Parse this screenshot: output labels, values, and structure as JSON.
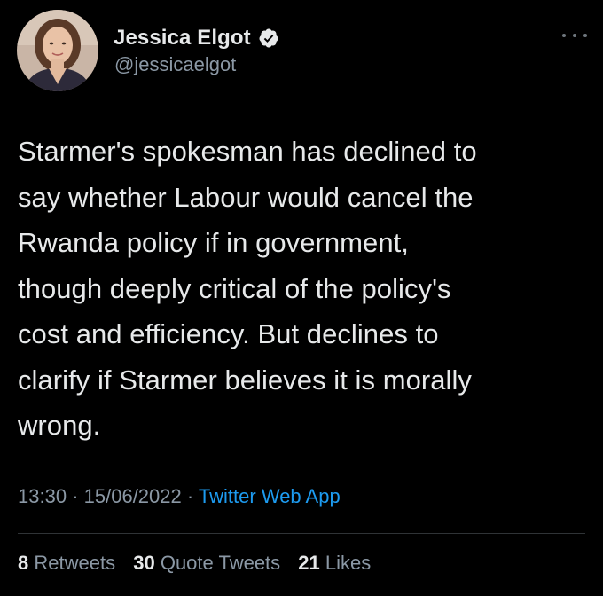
{
  "author": {
    "display_name": "Jessica Elgot",
    "handle": "@jessicaelgot",
    "verified": true,
    "avatar_icon": "profile-photo"
  },
  "tweet": {
    "text": "Starmer's spokesman has declined to\nsay whether Labour would cancel the\nRwanda policy if in government,\nthough deeply critical of the policy's\ncost and efficiency. But declines to\nclarify if Starmer believes it is morally\nwrong.",
    "time": "13:30",
    "separator": "·",
    "date": "15/06/2022",
    "source": "Twitter Web App"
  },
  "stats": {
    "retweets_count": "8",
    "retweets_label": "Retweets",
    "quotes_count": "30",
    "quotes_label": "Quote Tweets",
    "likes_count": "21",
    "likes_label": "Likes"
  },
  "colors": {
    "background": "#000000",
    "text_primary": "#e7e9ea",
    "text_secondary": "#8b98a5",
    "link": "#1d9bf0",
    "verified": "#e7e9ea",
    "divider": "#2f3336"
  }
}
